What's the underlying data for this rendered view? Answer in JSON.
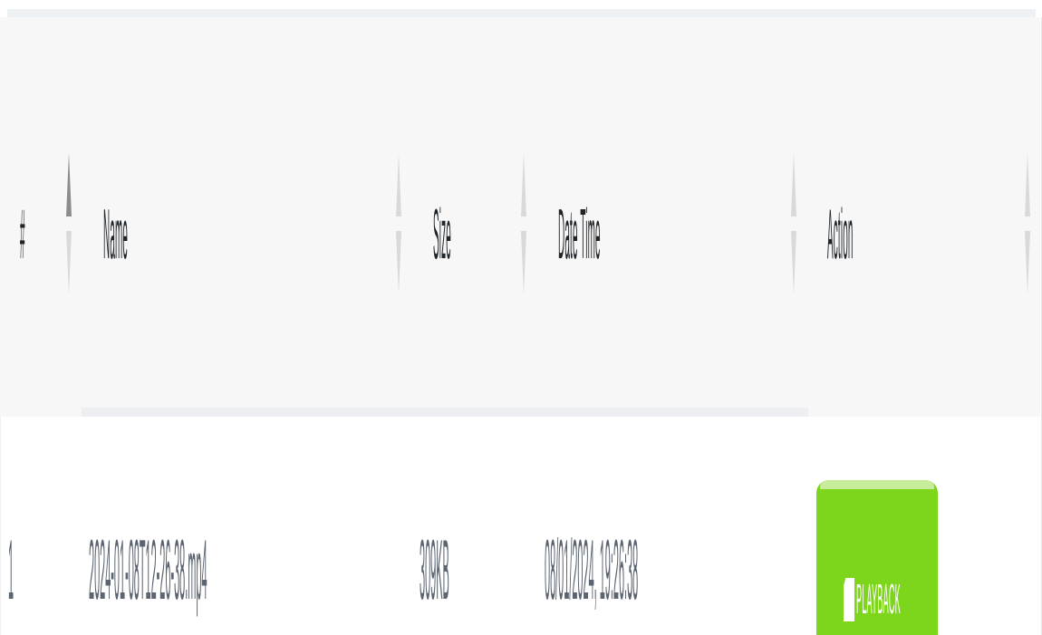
{
  "table": {
    "columns": [
      {
        "key": "index",
        "label": "#"
      },
      {
        "key": "name",
        "label": "Name"
      },
      {
        "key": "size",
        "label": "Size"
      },
      {
        "key": "datetime",
        "label": "Date Time"
      },
      {
        "key": "action",
        "label": "Action"
      }
    ],
    "rows": [
      {
        "index": "1",
        "name": "2024-01-08T12-26-38.mp4",
        "size": "309KB",
        "datetime": "08/01/2024, 19:26:38",
        "action": {
          "label": "PLAYBACK",
          "icon": "play-icon",
          "color": "#7ed61c"
        }
      }
    ]
  },
  "colors": {
    "header_bg": "#f7f7f8",
    "header_text": "#1f2428",
    "cell_text": "#5b6470",
    "action_button": "#7ed61c"
  }
}
